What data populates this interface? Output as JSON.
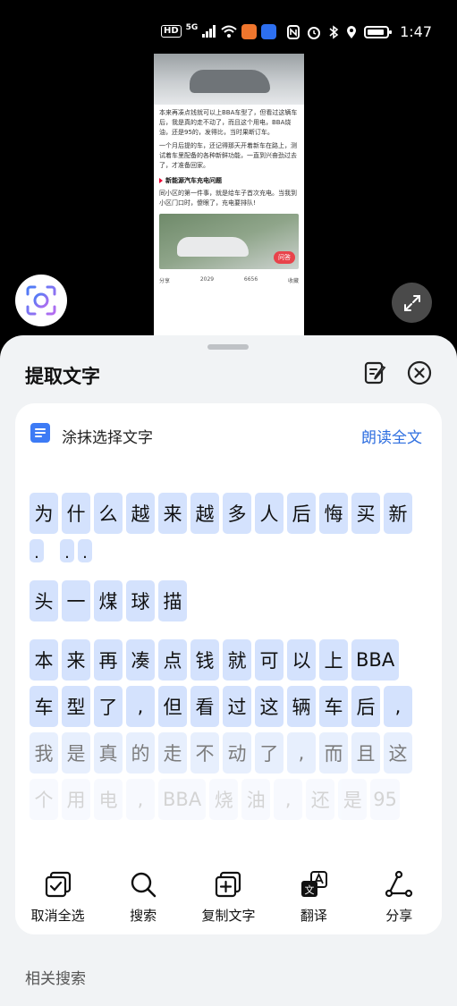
{
  "status_bar": {
    "hd": "HD",
    "network": "5G",
    "time": "1:47"
  },
  "preview": {
    "para1": "本来再凑点钱就可以上BBA车型了，但看过这辆车后，我是真的走不动了，而且这个用电，BBA烧油，还是95的，发得比，当时果断订车。",
    "para2": "一个月后提的车，还记得那天开着新车在路上，测试着车里配备的各种新鲜功能，一直到兴奋劲过去了，才准备回家。",
    "section": "新能源汽车充电问题",
    "para3": "同小区的第一件事，就是给车子首次充电。当我到小区门口时，傻眼了，充电要排队!",
    "ask_label": "问答",
    "share": "分享",
    "comments": "2029",
    "likes": "6656",
    "fav": "收藏"
  },
  "sheet": {
    "title": "提取文字",
    "smear_label": "涂抹选择文字",
    "read_all": "朗读全文"
  },
  "chips": {
    "row1": [
      "为",
      "什",
      "么",
      "越",
      "来",
      "越",
      "多",
      "人",
      "后",
      "悔",
      "买",
      "新"
    ],
    "row2": [
      ".",
      ".",
      "."
    ],
    "row3": [
      "头",
      "一",
      "煤",
      "球",
      "描"
    ],
    "row4": [
      "本",
      "来",
      "再",
      "凑",
      "点",
      "钱",
      "就",
      "可",
      "以",
      "上",
      "BBA"
    ],
    "row5": [
      "车",
      "型",
      "了",
      ",",
      "但",
      "看",
      "过",
      "这",
      "辆",
      "车",
      "后",
      ","
    ],
    "row6": [
      "我",
      "是",
      "真",
      "的",
      "走",
      "不",
      "动",
      "了",
      ",",
      "而",
      "且",
      "这"
    ],
    "row7": [
      "个",
      "用",
      "电",
      ",",
      "BBA",
      "烧",
      "油",
      ",",
      "还",
      "是",
      "95"
    ]
  },
  "toolbar": {
    "deselect": "取消全选",
    "search": "搜索",
    "copy": "复制文字",
    "translate": "翻译",
    "share": "分享"
  },
  "related": "相关搜索",
  "colors": {
    "accent": "#2f6fe0",
    "chip": "#d4e2fd",
    "sheet_bg": "#f1f3f5"
  }
}
